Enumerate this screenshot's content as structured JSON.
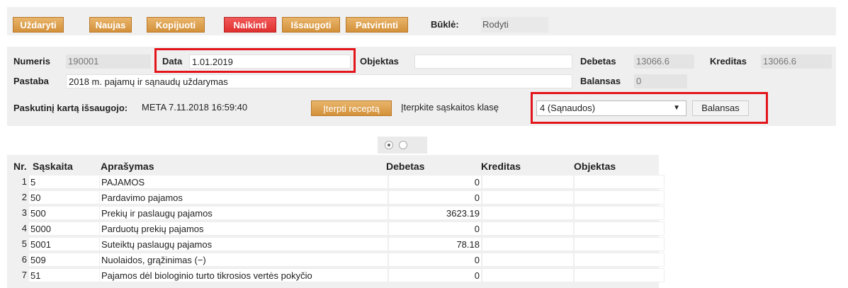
{
  "toolbar": {
    "buttons": [
      "Uždaryti",
      "Naujas",
      "Kopijuoti",
      "Naikinti",
      "Išsaugoti",
      "Patvirtinti"
    ],
    "state_label": "Būklė:",
    "state_value": "Rodyti",
    "accent_color": "#d8973f",
    "danger_color": "#e3302f"
  },
  "form": {
    "number_label": "Numeris",
    "number_value": "190001",
    "date_label": "Data",
    "date_value": "1.01.2019",
    "object_label": "Objektas",
    "object_value": "",
    "debit_label": "Debetas",
    "debit_value": "13066.6",
    "credit_label": "Kreditas",
    "credit_value": "13066.6",
    "note_label": "Pastaba",
    "note_value": "2018 m. pajamų ir sąnaudų uždarymas",
    "balance_label": "Balansas",
    "balance_value": "0",
    "saved_label": "Paskutinį kartą išsaugojo:",
    "saved_value": "META 7.11.2018 16:59:40",
    "insert_recipe_button": "Įterpti receptą",
    "insert_class_label": "Įterpkite sąskaitos klasę",
    "class_selected": "4 (Sąnaudos)",
    "balance_button": "Balansas",
    "highlight_color": "#e3151b"
  },
  "table": {
    "headers": {
      "nr": "Nr.",
      "account": "Sąskaita",
      "description": "Aprašymas",
      "debit": "Debetas",
      "credit": "Kreditas",
      "object": "Objektas"
    },
    "rows": [
      {
        "nr": "1",
        "account": "5",
        "description": "PAJAMOS",
        "debit": "0",
        "credit": "",
        "object": ""
      },
      {
        "nr": "2",
        "account": "50",
        "description": "Pardavimo pajamos",
        "debit": "0",
        "credit": "",
        "object": ""
      },
      {
        "nr": "3",
        "account": "500",
        "description": "Prekių ir paslaugų pajamos",
        "debit": "3623.19",
        "credit": "",
        "object": ""
      },
      {
        "nr": "4",
        "account": "5000",
        "description": "Parduotų prekių pajamos",
        "debit": "0",
        "credit": "",
        "object": ""
      },
      {
        "nr": "5",
        "account": "5001",
        "description": "Suteiktų paslaugų pajamos",
        "debit": "78.18",
        "credit": "",
        "object": ""
      },
      {
        "nr": "6",
        "account": "509",
        "description": "Nuolaidos, grąžinimas (−)",
        "debit": "0",
        "credit": "",
        "object": ""
      },
      {
        "nr": "7",
        "account": "51",
        "description": "Pajamos dėl biologinio turto tikrosios vertės pokyčio",
        "debit": "0",
        "credit": "",
        "object": ""
      }
    ]
  }
}
